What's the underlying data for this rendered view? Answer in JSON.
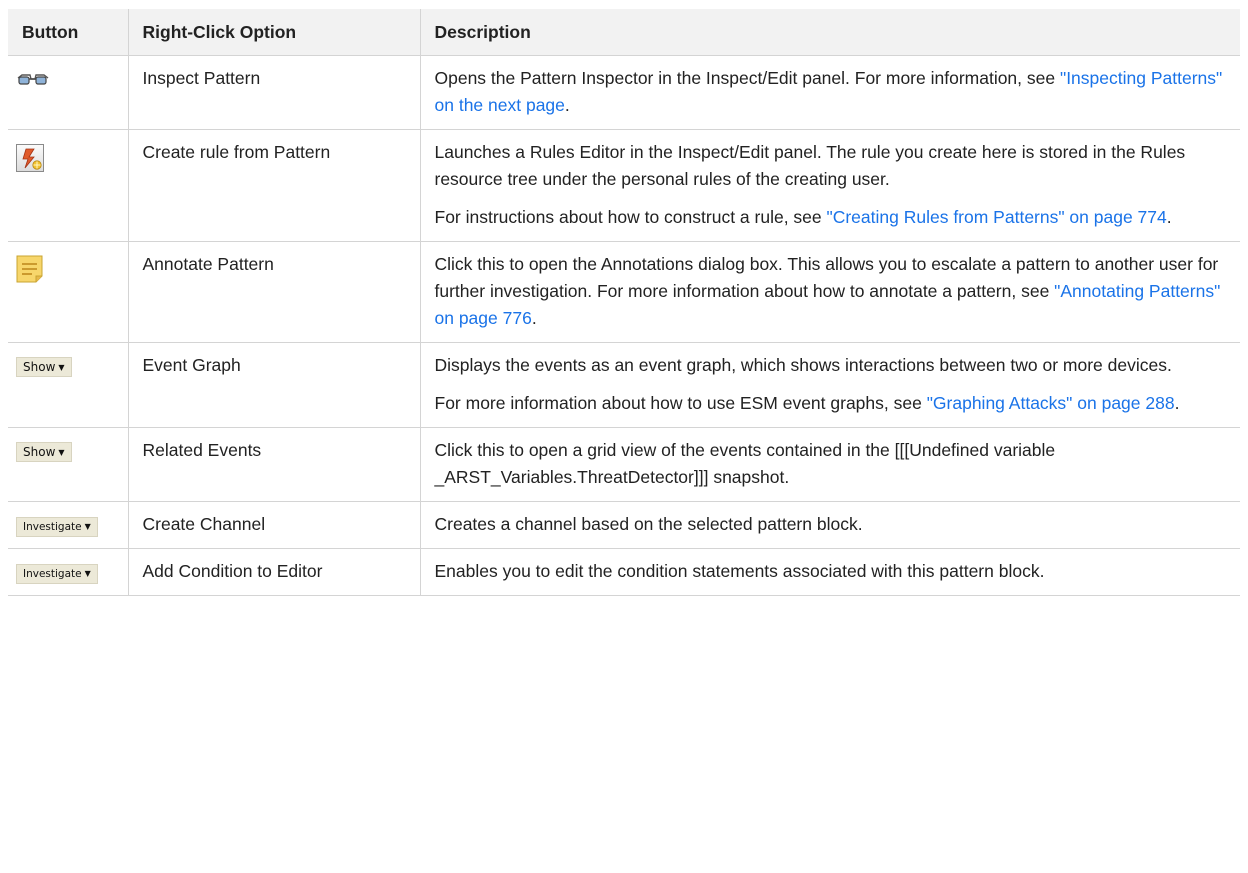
{
  "table": {
    "headers": [
      "Button",
      "Right-Click Option",
      "Description"
    ],
    "rows": [
      {
        "icon": "glasses-icon",
        "option": "Inspect Pattern",
        "desc": [
          {
            "text": "Opens the Pattern Inspector in the Inspect/Edit panel. For more information, see ",
            "link": "\"Inspecting Patterns\" on the next page",
            "after": "."
          }
        ]
      },
      {
        "icon": "create-rule-icon",
        "option": "Create rule from Pattern",
        "desc": [
          {
            "text": "Launches a Rules Editor in the Inspect/Edit panel. The rule you create here is stored in the Rules resource tree under the personal rules of the creating user.",
            "link": "",
            "after": ""
          },
          {
            "text": "For instructions about how to construct a rule, see ",
            "link": "\"Creating Rules from Patterns\" on page 774",
            "after": "."
          }
        ]
      },
      {
        "icon": "annotate-note-icon",
        "option": "Annotate Pattern",
        "desc": [
          {
            "text": "Click this to open the Annotations dialog box. This allows you to escalate a pattern to another user for further investigation. For more information about how to annotate a pattern, see ",
            "link": "\"Annotating Patterns\" on page 776",
            "after": "."
          }
        ]
      },
      {
        "icon": "show-dropdown-icon",
        "button_label": "Show",
        "option": "Event Graph",
        "desc": [
          {
            "text": "Displays the events as an event graph, which shows interactions between two or more devices.",
            "link": "",
            "after": ""
          },
          {
            "text": "For more information about how to use ESM event graphs, see ",
            "link": "\"Graphing Attacks\" on page 288",
            "after": "."
          }
        ]
      },
      {
        "icon": "show-dropdown-icon",
        "button_label": "Show",
        "option": "Related Events",
        "desc": [
          {
            "text": "Click this to open a grid view of the events contained in the [[[Undefined variable _ARST_Variables.ThreatDetector]]] snapshot.",
            "link": "",
            "after": ""
          }
        ]
      },
      {
        "icon": "investigate-dropdown-icon",
        "button_label": "Investigate",
        "option": "Create Channel",
        "desc": [
          {
            "text": "Creates a channel based on the selected pattern block.",
            "link": "",
            "after": ""
          }
        ]
      },
      {
        "icon": "investigate-dropdown-icon",
        "button_label": "Investigate",
        "option": "Add Condition to Editor",
        "desc": [
          {
            "text": "Enables you to edit the condition statements associated with this pattern block.",
            "link": "",
            "after": ""
          }
        ]
      }
    ]
  },
  "colors": {
    "link": "#1a73e8",
    "header_bg": "#f2f2f2",
    "border": "#d4d4d4"
  }
}
